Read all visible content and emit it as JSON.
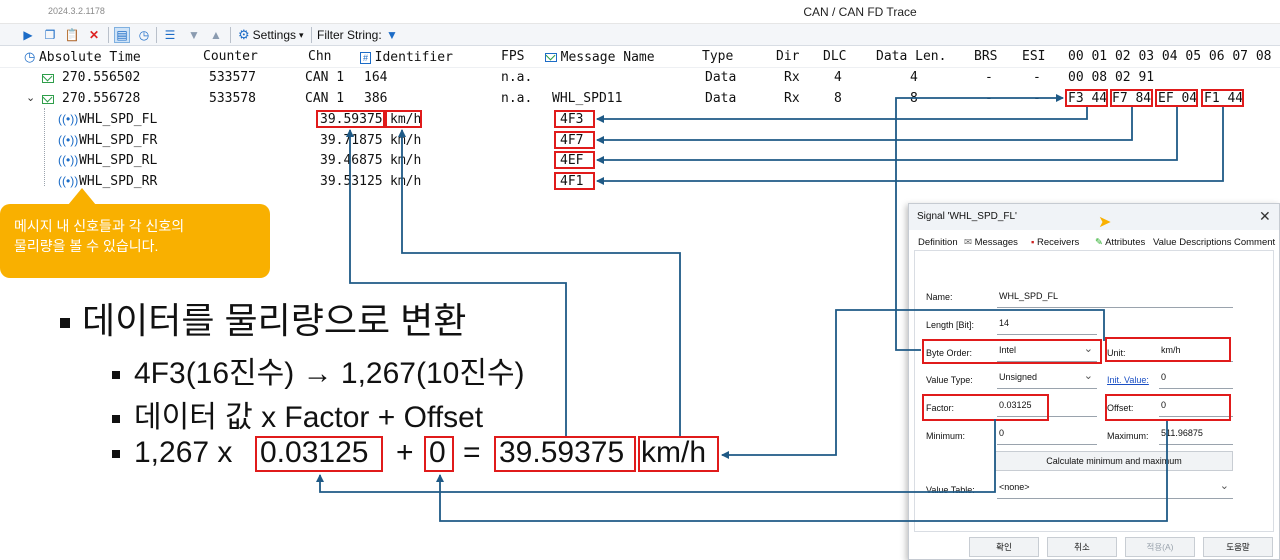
{
  "window": {
    "version": "2024.3.2.1178",
    "title": "CAN / CAN FD Trace"
  },
  "toolbar": {
    "settings_label": "Settings",
    "filter_label": "Filter String:",
    "icons": [
      "play-icon",
      "copy-icon",
      "paste-icon",
      "clear-icon",
      "calendar-icon",
      "clock-icon",
      "sort-icon",
      "arrow-down-icon",
      "arrow-up-icon",
      "gear-icon",
      "filter-icon"
    ]
  },
  "trace": {
    "headers": {
      "time": "Absolute Time",
      "counter": "Counter",
      "chn": "Chn",
      "identifier": "Identifier",
      "fps": "FPS",
      "message_name": "Message Name",
      "type": "Type",
      "dir": "Dir",
      "dlc": "DLC",
      "data_len": "Data Len.",
      "brs": "BRS",
      "esi": "ESI",
      "bytes": "00 01 02 03 04 05 06 07 08"
    },
    "messages": [
      {
        "time": "270.556502",
        "counter": "533577",
        "chn": "CAN 1",
        "identifier": "164",
        "fps": "n.a.",
        "message_name": "",
        "type": "Data",
        "dir": "Rx",
        "dlc": "4",
        "data_len": "4",
        "brs": "-",
        "esi": "-",
        "data": "00 08 02 91"
      },
      {
        "time": "270.556728",
        "counter": "533578",
        "chn": "CAN 1",
        "identifier": "386",
        "fps": "n.a.",
        "message_name": "WHL_SPD11",
        "type": "Data",
        "dir": "Rx",
        "dlc": "8",
        "data_len": "8",
        "brs": "-",
        "esi": "-",
        "data": "F3 44  F7 84  EF 04  F1 44"
      }
    ],
    "data_groups": [
      "F3 44",
      "F7 84",
      "EF 04",
      "F1 44"
    ],
    "signals": [
      {
        "name": "WHL_SPD_FL",
        "value": "39.59375",
        "unit": "km/h",
        "raw": "4F3"
      },
      {
        "name": "WHL_SPD_FR",
        "value": "39.71875",
        "unit": "km/h",
        "raw": "4F7"
      },
      {
        "name": "WHL_SPD_RL",
        "value": "39.46875",
        "unit": "km/h",
        "raw": "4EF"
      },
      {
        "name": "WHL_SPD_RR",
        "value": "39.53125",
        "unit": "km/h",
        "raw": "4F1"
      }
    ]
  },
  "callout": {
    "line1": "메시지 내 신호들과 각 신호의",
    "line2": "물리량을 볼 수 있습니다."
  },
  "slide": {
    "heading": "데이터를 물리량으로 변환",
    "bullet1": "4F3(16진수) → 1,267(10진수)",
    "bullet2": "데이터 값 x Factor + Offset",
    "formula": {
      "raw": "1,267 x",
      "factor": "0.03125",
      "plus": "+",
      "offset": "0",
      "equals": "=",
      "result": "39.59375",
      "unit": "km/h"
    }
  },
  "dialog": {
    "title": "Signal 'WHL_SPD_FL'",
    "tabs": [
      "Definition",
      "Messages",
      "Receivers",
      "Attributes",
      "Value Descriptions",
      "Comment"
    ],
    "fields": {
      "name_label": "Name:",
      "name_value": "WHL_SPD_FL",
      "length_label": "Length [Bit]:",
      "length_value": "14",
      "byte_order_label": "Byte Order:",
      "byte_order_value": "Intel",
      "unit_label": "Unit:",
      "unit_value": "km/h",
      "value_type_label": "Value Type:",
      "value_type_value": "Unsigned",
      "init_value_label": "Init. Value:",
      "init_value_value": "0",
      "factor_label": "Factor:",
      "factor_value": "0.03125",
      "offset_label": "Offset:",
      "offset_value": "0",
      "minimum_label": "Minimum:",
      "minimum_value": "0",
      "maximum_label": "Maximum:",
      "maximum_value": "511.96875",
      "value_table_label": "Value Table:",
      "value_table_value": "<none>"
    },
    "calc_button": "Calculate minimum and maximum",
    "buttons": {
      "ok": "확인",
      "cancel": "취소",
      "apply": "적용(A)",
      "help": "도움말"
    }
  },
  "colors": {
    "highlight_red": "#e01b1b",
    "arrow_blue": "#1f5a86",
    "callout_amber": "#f9b000",
    "message_icon_green": "#2e9e4a",
    "signal_icon_blue": "#1c6cc7"
  }
}
